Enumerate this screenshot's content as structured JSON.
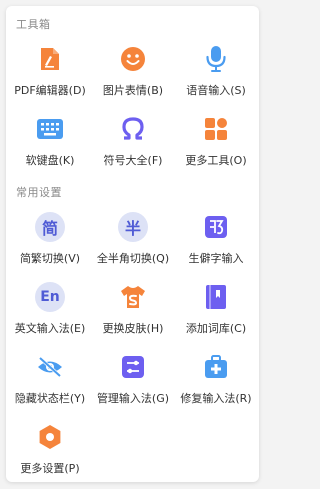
{
  "sections": [
    {
      "title": "工具箱",
      "items": [
        {
          "label": "PDF编辑器(D)",
          "icon": "pdf-editor-icon"
        },
        {
          "label": "图片表情(B)",
          "icon": "smiley-icon"
        },
        {
          "label": "语音输入(S)",
          "icon": "microphone-icon"
        },
        {
          "label": "软键盘(K)",
          "icon": "keyboard-icon"
        },
        {
          "label": "符号大全(F)",
          "icon": "omega-symbol-icon"
        },
        {
          "label": "更多工具(O)",
          "icon": "grid-tools-icon"
        }
      ]
    },
    {
      "title": "常用设置",
      "items": [
        {
          "label": "简繁切换(V)",
          "icon": "simplified-traditional-icon",
          "glyph": "简"
        },
        {
          "label": "全半角切换(Q)",
          "icon": "half-full-width-icon",
          "glyph": "半"
        },
        {
          "label": "生僻字输入",
          "icon": "rare-char-icon"
        },
        {
          "label": "英文输入法(E)",
          "icon": "english-input-icon",
          "glyph": "En"
        },
        {
          "label": "更换皮肤(H)",
          "icon": "skin-shirt-icon"
        },
        {
          "label": "添加词库(C)",
          "icon": "dictionary-icon"
        },
        {
          "label": "隐藏状态栏(Y)",
          "icon": "hide-eye-icon"
        },
        {
          "label": "管理输入法(G)",
          "icon": "manage-sliders-icon"
        },
        {
          "label": "修复输入法(R)",
          "icon": "repair-kit-icon"
        },
        {
          "label": "更多设置(P)",
          "icon": "settings-hexagon-icon"
        }
      ]
    }
  ],
  "colors": {
    "orange": "#f5843b",
    "blue": "#4a9cf0",
    "purple": "#6d5ff0",
    "lavender_bg": "#dde2f6",
    "lavender_fg": "#4f5bd5"
  }
}
